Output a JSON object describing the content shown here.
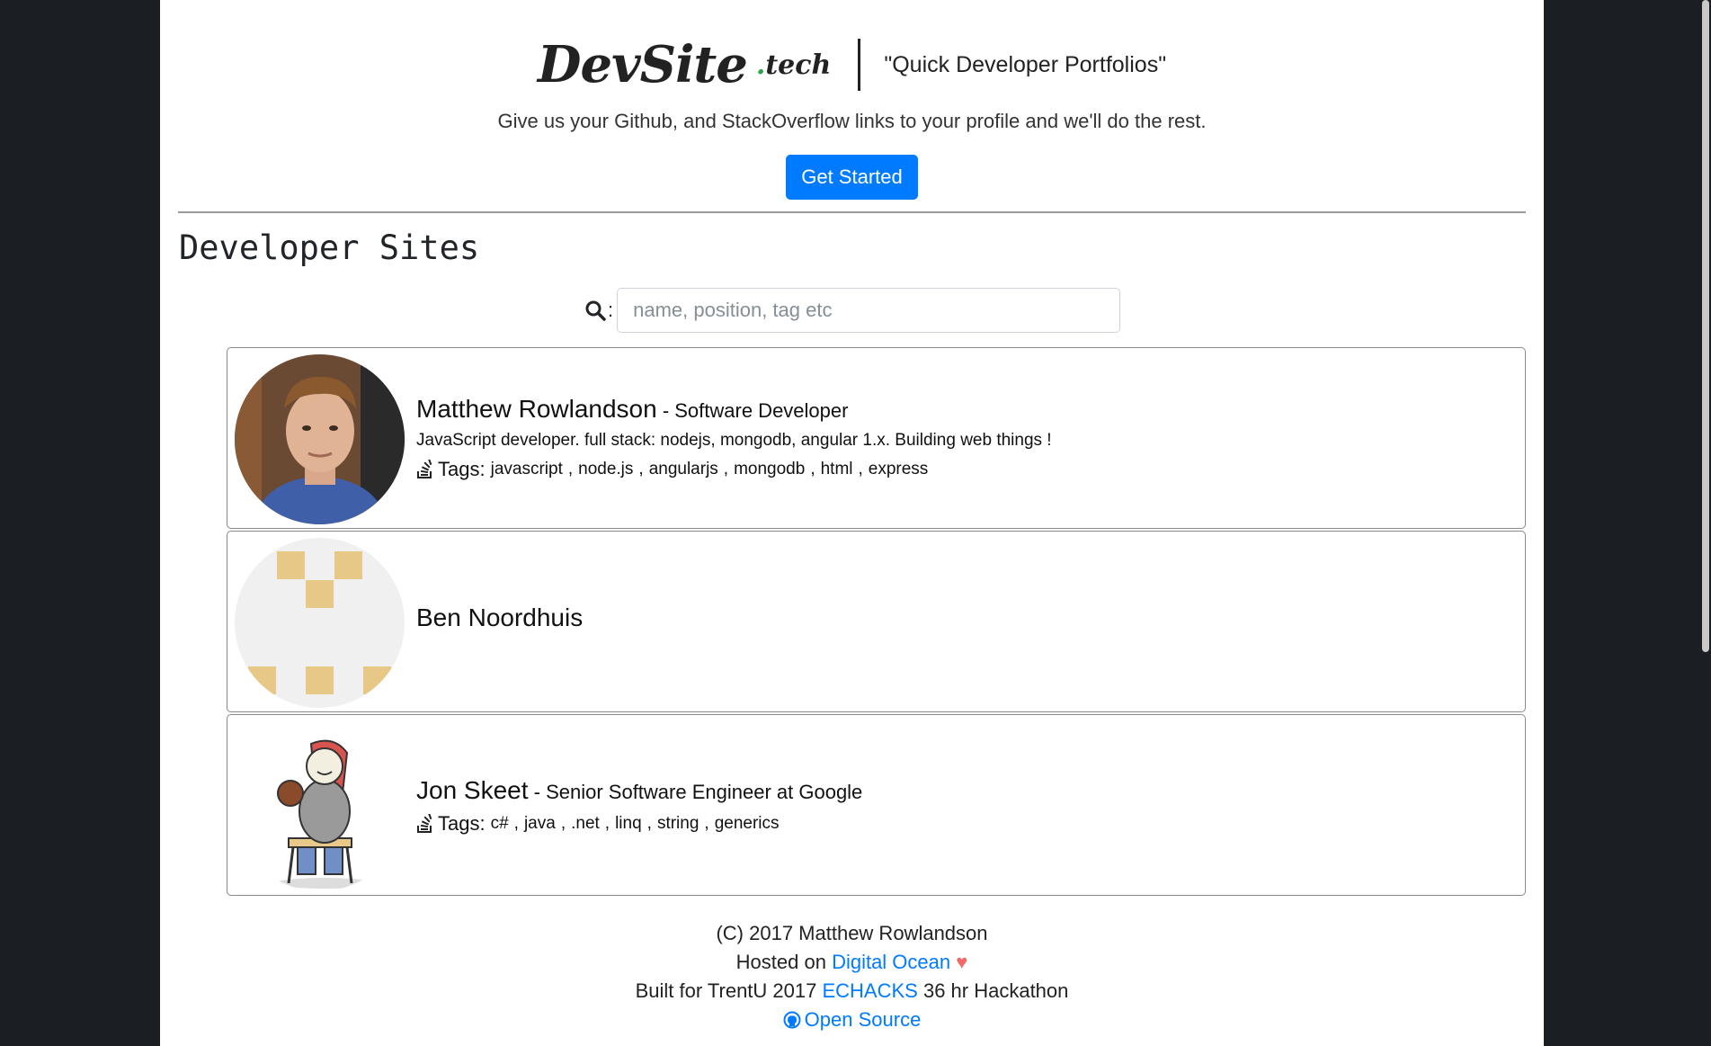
{
  "brand": {
    "name": "DevSite",
    "tld": ".tech",
    "tld_dot": ".",
    "tld_word": "tech",
    "tagline": "\"Quick Developer Portfolios\"",
    "subtitle": "Give us your Github, and StackOverflow links to your profile and we'll do the rest.",
    "cta_label": "Get Started",
    "accent": "#007bff",
    "tld_color": "#28a745"
  },
  "section": {
    "title": "Developer Sites"
  },
  "search": {
    "colon": ":",
    "placeholder": "name, position, tag etc",
    "value": ""
  },
  "developers": [
    {
      "name": "Matthew Rowlandson",
      "role": " - Software Developer",
      "bio": "JavaScript developer. full stack: nodejs, mongodb, angular 1.x. Building web things !",
      "tags_label": "Tags:",
      "tags": [
        "javascript",
        "node.js",
        "angularjs",
        "mongodb",
        "html",
        "express"
      ],
      "avatar": "photo"
    },
    {
      "name": "Ben Noordhuis",
      "role": "",
      "bio": "",
      "tags_label": "",
      "tags": [],
      "avatar": "identicon"
    },
    {
      "name": "Jon Skeet",
      "role": " - Senior Software Engineer at Google",
      "bio": "",
      "tags_label": "Tags:",
      "tags": [
        "c#",
        "java",
        ".net",
        "linq",
        "string",
        "generics"
      ],
      "avatar": "cartoon"
    }
  ],
  "footer": {
    "copyright": "(C) 2017 Matthew Rowlandson",
    "hosted_prefix": "Hosted on ",
    "hosted_link": "Digital Ocean",
    "heart": "♥",
    "built_prefix": "Built for TrentU 2017 ",
    "built_link": "ECHACKS",
    "built_suffix": " 36 hr Hackathon",
    "open_source": "Open Source"
  }
}
